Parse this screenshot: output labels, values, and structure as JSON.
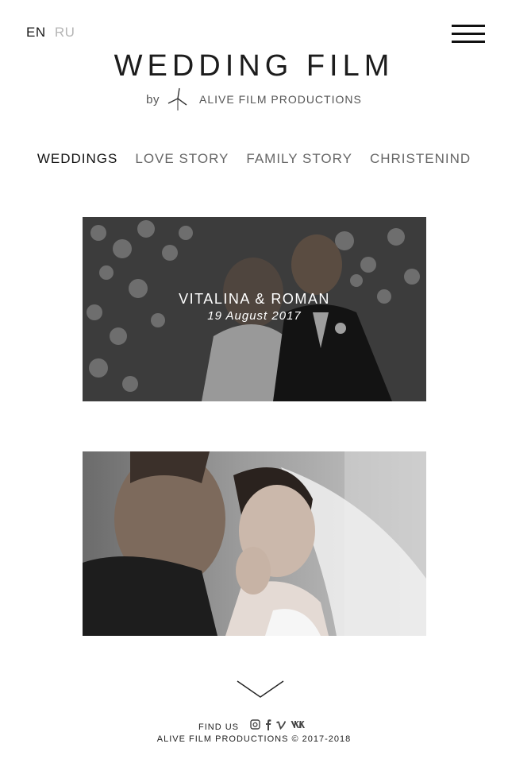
{
  "lang": {
    "active": "EN",
    "inactive": "RU"
  },
  "header": {
    "title": "WEDDING FILM",
    "by": "by",
    "company": "ALIVE FILM PRODUCTIONS"
  },
  "nav": {
    "items": [
      {
        "label": "WEDDINGS"
      },
      {
        "label": "LOVE STORY"
      },
      {
        "label": "FAMILY STORY"
      },
      {
        "label": "CHRISTENIND"
      }
    ]
  },
  "films": [
    {
      "names": "VITALINA & ROMAN",
      "date": "19 August 2017"
    },
    {
      "names": "",
      "date": ""
    }
  ],
  "footer": {
    "find_us": "FIND US",
    "social": [
      "instagram-icon",
      "facebook-icon",
      "vimeo-icon",
      "vk-icon"
    ],
    "copyright": "ALIVE FILM PRODUCTIONS © 2017-2018"
  }
}
